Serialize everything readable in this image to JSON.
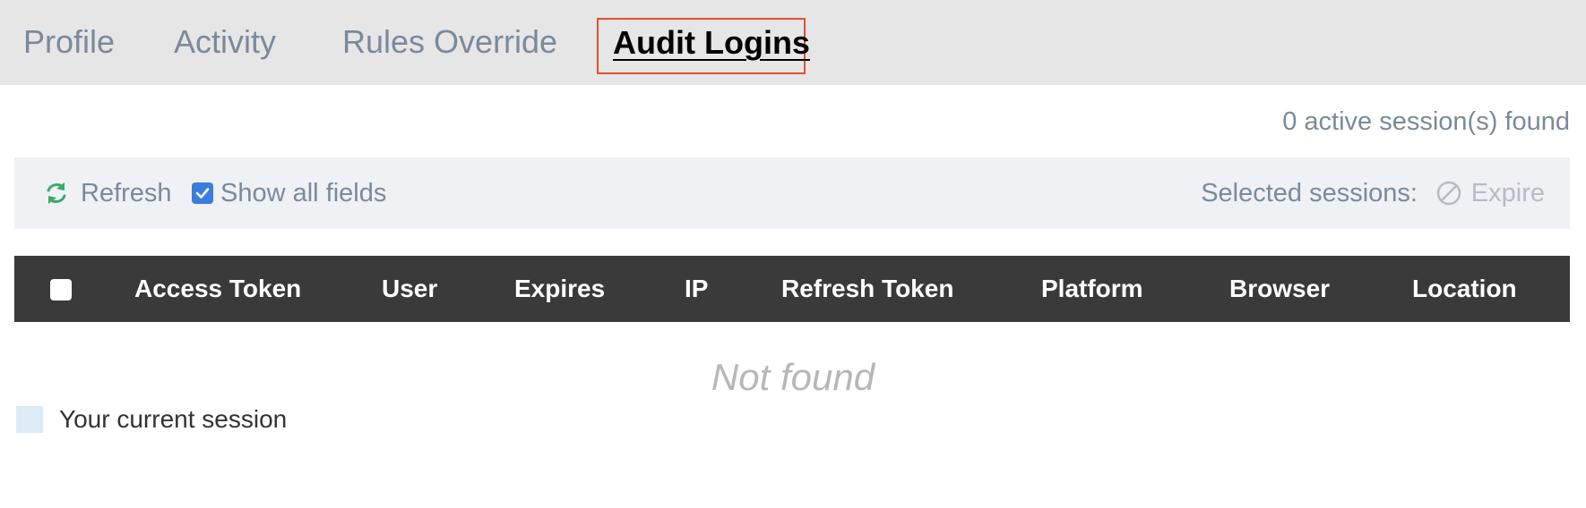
{
  "tabs": {
    "profile": "Profile",
    "activity": "Activity",
    "rules_override": "Rules Override",
    "audit_logins": "Audit Logins",
    "active": "Audit Logins"
  },
  "session_count": "0 active session(s) found",
  "toolbar": {
    "refresh_label": "Refresh",
    "refresh_icon": "refresh-icon",
    "show_all_fields_label": "Show all fields",
    "show_all_fields_checked": true,
    "selected_sessions_label": "Selected sessions:",
    "expire_label": "Expire",
    "expire_icon": "block-icon",
    "expire_enabled": false
  },
  "table": {
    "columns": [
      "Access Token",
      "User",
      "Expires",
      "IP",
      "Refresh Token",
      "Platform",
      "Browser",
      "Location"
    ],
    "rows": [],
    "empty_text": "Not found"
  },
  "legend": {
    "label": "Your current session",
    "color": "#dcebf6"
  },
  "colors": {
    "tab_bar": "#e6e6e6",
    "active_tab_border": "#e0502f",
    "header_bg": "#3a3a3a",
    "refresh_icon": "#3aaa6a",
    "checkbox": "#3b7ddd"
  }
}
